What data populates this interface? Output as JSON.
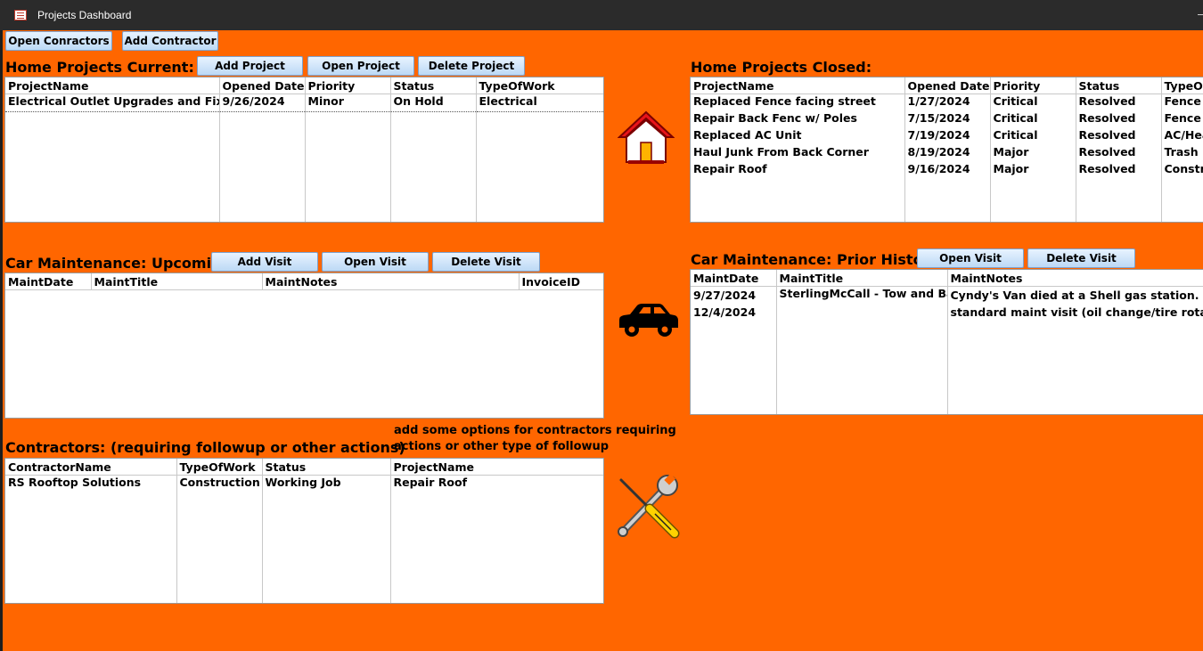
{
  "window": {
    "title": "Projects Dashboard"
  },
  "toolbar": {
    "open_contractors": "Open Conractors",
    "add_contractor": "Add Contractor"
  },
  "home_current": {
    "heading": "Home Projects Current:",
    "add": "Add Project",
    "open": "Open Project",
    "delete": "Delete Project",
    "columns": [
      "ProjectName",
      "Opened Date",
      "Priority",
      "Status",
      "TypeOfWork"
    ],
    "rows": [
      [
        "Electrical Outlet Upgrades and Fixes",
        "9/26/2024",
        "Minor",
        "On Hold",
        "Electrical"
      ]
    ]
  },
  "home_closed": {
    "heading": "Home Projects Closed:",
    "columns": [
      "ProjectName",
      "Opened Date",
      "Priority",
      "Status",
      "TypeOf"
    ],
    "rows": [
      [
        "Replaced Fence facing street",
        "1/27/2024",
        "Critical",
        "Resolved",
        "Fence"
      ],
      [
        "Repair Back Fenc w/ Poles",
        "7/15/2024",
        "Critical",
        "Resolved",
        "Fence"
      ],
      [
        "Replaced AC Unit",
        "7/19/2024",
        "Critical",
        "Resolved",
        "AC/Hea"
      ],
      [
        "Haul Junk From Back Corner",
        "8/19/2024",
        "Major",
        "Resolved",
        "Trash"
      ],
      [
        "Repair Roof",
        "9/16/2024",
        "Major",
        "Resolved",
        "Constru"
      ]
    ]
  },
  "car_upcoming": {
    "heading": "Car Maintenance: Upcoming",
    "add": "Add Visit",
    "open": "Open Visit",
    "delete": "Delete Visit",
    "columns": [
      "MaintDate",
      "MaintTitle",
      "MaintNotes",
      "InvoiceID"
    ]
  },
  "car_prior": {
    "heading": "Car Maintenance: Prior History",
    "open": "Open Visit",
    "delete": "Delete Visit",
    "columns": [
      "MaintDate",
      "MaintTitle",
      "MaintNotes"
    ],
    "dates": [
      "9/27/2024",
      "12/4/2024"
    ],
    "title": "SterlingMcCall - Tow and Batte",
    "notes": "Cyndy's Van died at a Shell gas station. Had to standard maint visit (oil change/tire rotation/s"
  },
  "contractors": {
    "heading": "Contractors: (requiring followup or other actions)",
    "note": "add some options for contractors requiring actions or other type of followup",
    "columns": [
      "ContractorName",
      "TypeOfWork",
      "Status",
      "ProjectName"
    ],
    "rows": [
      [
        "RS Rooftop Solutions",
        "Construction",
        "Working Job",
        "Repair Roof"
      ]
    ]
  },
  "colors": {
    "background": "#ff6600",
    "titlebar": "#2b2b2b",
    "button": "#c8e1fa"
  },
  "icons": [
    "house-icon",
    "car-icon",
    "tools-icon"
  ]
}
